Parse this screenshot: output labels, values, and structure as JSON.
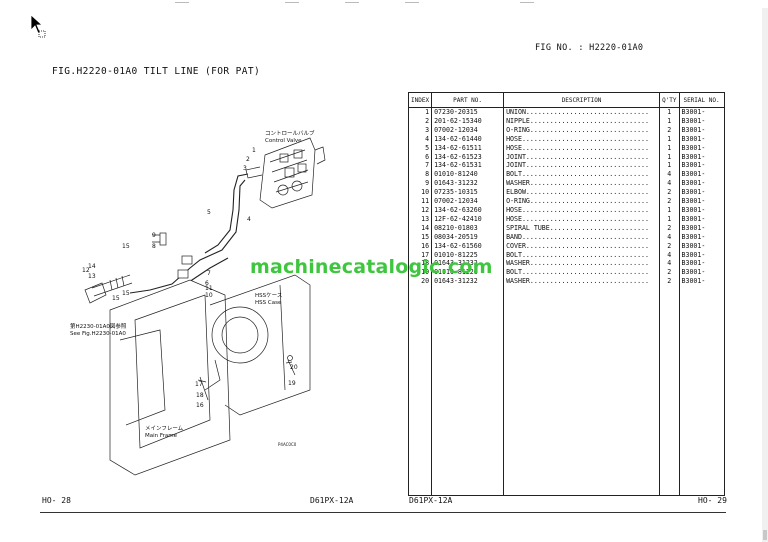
{
  "header": {
    "fig_no": "FIG NO. : H2220-01A0",
    "fig_title": "FIG.H2220-01A0  TILT LINE (FOR PAT)"
  },
  "drawing": {
    "control_valve_jp": "コントロールバルブ",
    "control_valve_en": "Control Valve",
    "hss_case_jp": "HSSケース",
    "hss_case_en": "HSS Case",
    "main_frame_jp": "メインフレーム",
    "main_frame_en": "Main Frame",
    "see_fig_jp": "第H2230-01A0図参照",
    "see_fig_en": "See Fig.H2230-01A0",
    "drawing_code": "P4AC0C0",
    "callouts": [
      "1",
      "2",
      "3",
      "4",
      "5",
      "6",
      "7",
      "8",
      "9",
      "10",
      "11",
      "12",
      "13",
      "14",
      "15",
      "15",
      "15",
      "16",
      "17",
      "18",
      "19",
      "20"
    ]
  },
  "table": {
    "headers": {
      "index": "INDEX",
      "part_no": "PART NO.",
      "description": "DESCRIPTION",
      "qty": "Q'TY",
      "serial": "SERIAL NO."
    },
    "rows": [
      {
        "index": "1",
        "part_no": "07230-20315",
        "description": "UNION...............................",
        "qty": "1",
        "serial": "B3001-"
      },
      {
        "index": "2",
        "part_no": "201-62-15340",
        "description": "NIPPLE..............................",
        "qty": "1",
        "serial": "B3001-"
      },
      {
        "index": "3",
        "part_no": "07002-12034",
        "description": "O-RING..............................",
        "qty": "2",
        "serial": "B3001-"
      },
      {
        "index": "4",
        "part_no": "134-62-61440",
        "description": "HOSE................................",
        "qty": "1",
        "serial": "B3001-"
      },
      {
        "index": "5",
        "part_no": "134-62-61511",
        "description": "HOSE................................",
        "qty": "1",
        "serial": "B3001-"
      },
      {
        "index": "6",
        "part_no": "134-62-61523",
        "description": "JOINT...............................",
        "qty": "1",
        "serial": "B3001-"
      },
      {
        "index": "7",
        "part_no": "134-62-61531",
        "description": "JOINT...............................",
        "qty": "1",
        "serial": "B3001-"
      },
      {
        "index": "8",
        "part_no": "01010-81240",
        "description": "BOLT................................",
        "qty": "4",
        "serial": "B3001-"
      },
      {
        "index": "9",
        "part_no": "01643-31232",
        "description": "WASHER..............................",
        "qty": "4",
        "serial": "B3001-"
      },
      {
        "index": "10",
        "part_no": "07235-10315",
        "description": "ELBOW...............................",
        "qty": "2",
        "serial": "B3001-"
      },
      {
        "index": "11",
        "part_no": "07002-12034",
        "description": "O-RING..............................",
        "qty": "2",
        "serial": "B3001-"
      },
      {
        "index": "12",
        "part_no": "134-62-63260",
        "description": "HOSE................................",
        "qty": "1",
        "serial": "B3001-"
      },
      {
        "index": "13",
        "part_no": "12F-62-42410",
        "description": "HOSE................................",
        "qty": "1",
        "serial": "B3001-"
      },
      {
        "index": "14",
        "part_no": "08210-01803",
        "description": "SPIRAL TUBE.........................",
        "qty": "2",
        "serial": "B3001-"
      },
      {
        "index": "15",
        "part_no": "08034-20519",
        "description": "BAND................................",
        "qty": "4",
        "serial": "B3001-"
      },
      {
        "index": "16",
        "part_no": "134-62-61560",
        "description": "COVER...............................",
        "qty": "2",
        "serial": "B3001-"
      },
      {
        "index": "17",
        "part_no": "01010-81225",
        "description": "BOLT................................",
        "qty": "4",
        "serial": "B3001-"
      },
      {
        "index": "18",
        "part_no": "01643-31232",
        "description": "WASHER..............................",
        "qty": "4",
        "serial": "B3001-"
      },
      {
        "index": "19",
        "part_no": "01010-81220",
        "description": "BOLT................................",
        "qty": "2",
        "serial": "B3001-"
      },
      {
        "index": "20",
        "part_no": "01643-31232",
        "description": "WASHER..............................",
        "qty": "2",
        "serial": "B3001-"
      }
    ]
  },
  "watermark": "machinecatalogic.com",
  "footer": {
    "left_page": "HO-  28",
    "left_model": "D61PX-12A",
    "right_model": "D61PX-12A",
    "right_page": "HO-  29"
  }
}
